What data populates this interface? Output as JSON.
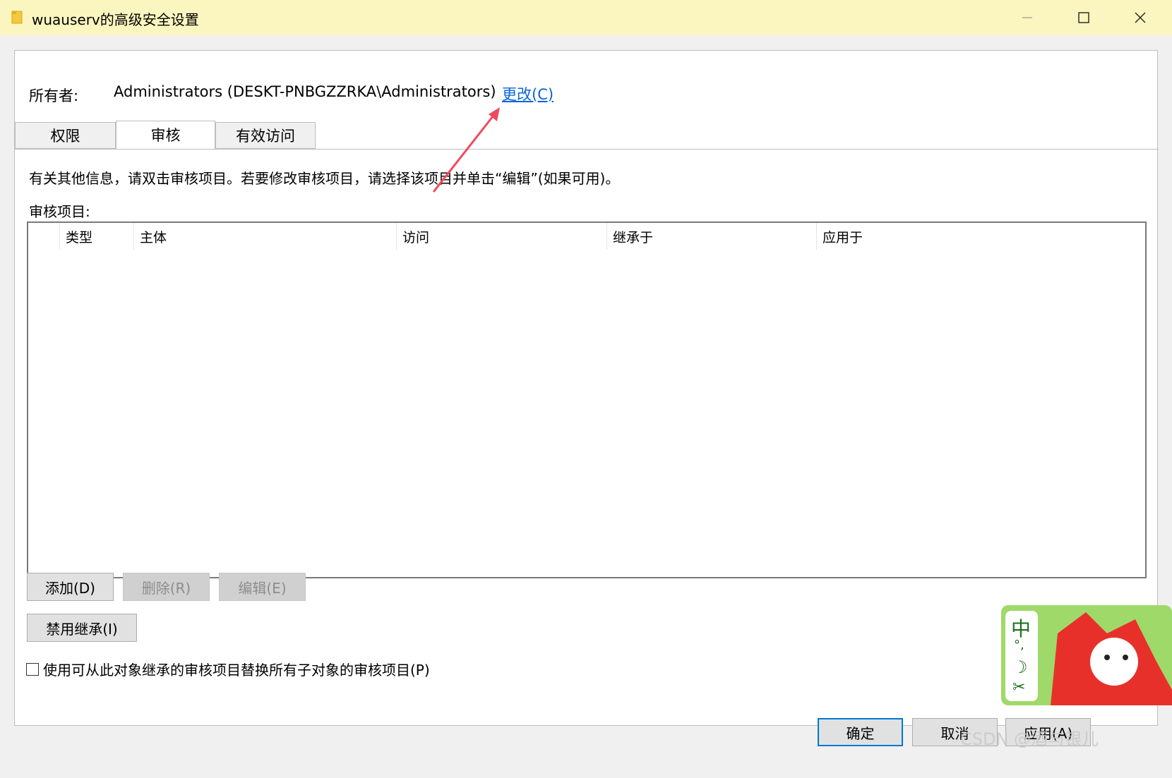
{
  "window": {
    "title": "wuauserv的高级安全设置",
    "minimize_glyph": "—",
    "maximize_glyph": "☐",
    "close_glyph": "✕"
  },
  "owner": {
    "label": "所有者:",
    "value": "Administrators (DESKT-PNBGZZRKA\\Administrators)",
    "change_link": "更改(C)"
  },
  "tabs": [
    {
      "label": "权限",
      "active": false
    },
    {
      "label": "审核",
      "active": true
    },
    {
      "label": "有效访问",
      "active": false
    }
  ],
  "info_text": "有关其他信息，请双击审核项目。若要修改审核项目，请选择该项目并单击“编辑”(如果可用)。",
  "audit_entries_label": "审核项目:",
  "table": {
    "columns": [
      "类型",
      "主体",
      "访问",
      "继承于",
      "应用于"
    ],
    "rows": []
  },
  "buttons": {
    "add": "添加(D)",
    "remove": "删除(R)",
    "edit": "编辑(E)",
    "disable_inheritance": "禁用继承(I)"
  },
  "replace_checkbox": {
    "label": "使用可从此对象继承的审核项目替换所有子对象的审核项目(P)",
    "checked": false
  },
  "dialog_buttons": {
    "ok": "确定",
    "cancel": "取消",
    "apply": "应用(A)"
  },
  "watermark": "CSDN @酒与银儿",
  "ime": {
    "items": [
      "中",
      "°,",
      "☽",
      "✂"
    ]
  },
  "colors": {
    "titlebar": "#fbf6bf",
    "link": "#0a64d8",
    "annotation_arrow": "#f04a5e",
    "primary_border": "#0078d7"
  }
}
